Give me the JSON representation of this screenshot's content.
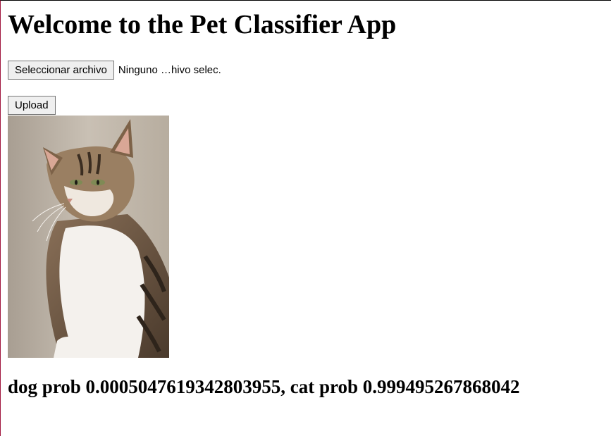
{
  "page": {
    "title": "Welcome to the Pet Classifier App"
  },
  "upload_form": {
    "choose_file_label": "Seleccionar archivo",
    "file_status": "Ninguno …hivo selec.",
    "upload_label": "Upload"
  },
  "result": {
    "text": "dog prob 0.0005047619342803955, cat prob 0.999495267868042"
  },
  "colors": {
    "button_bg": "#efefef",
    "button_border": "#767676",
    "left_edge": "#a0153e"
  }
}
